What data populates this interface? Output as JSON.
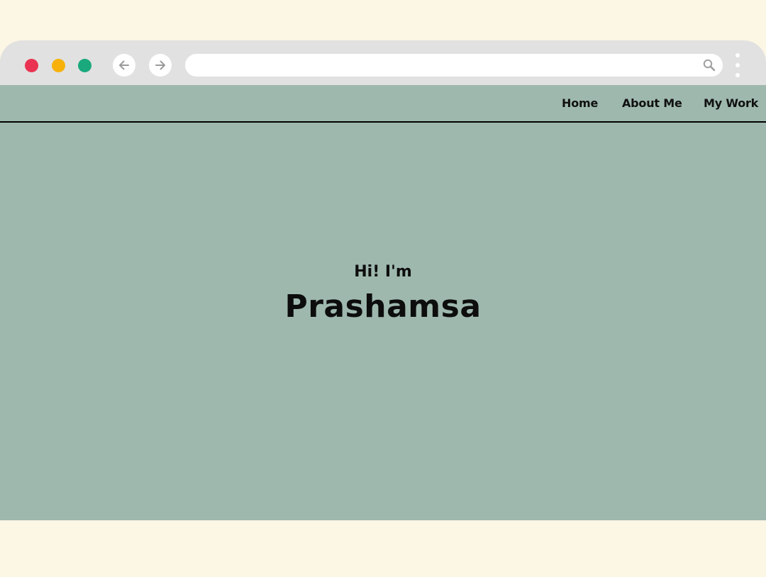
{
  "browser": {
    "window_controls": {
      "close_color": "#ea3352",
      "minimize_color": "#f7b10a",
      "maximize_color": "#1aa97c"
    },
    "back_icon": "arrow-left-icon",
    "forward_icon": "arrow-right-icon",
    "address_bar": {
      "value": "",
      "placeholder": "",
      "icon": "search-icon"
    },
    "menu_icon": "kebab-menu-icon"
  },
  "site": {
    "background_color": "#9eb8ad",
    "nav": {
      "items": [
        {
          "label": "Home"
        },
        {
          "label": "About Me"
        },
        {
          "label": "My Work"
        }
      ]
    },
    "hero": {
      "greeting": "Hi! I'm",
      "name": "Prashamsa"
    }
  }
}
